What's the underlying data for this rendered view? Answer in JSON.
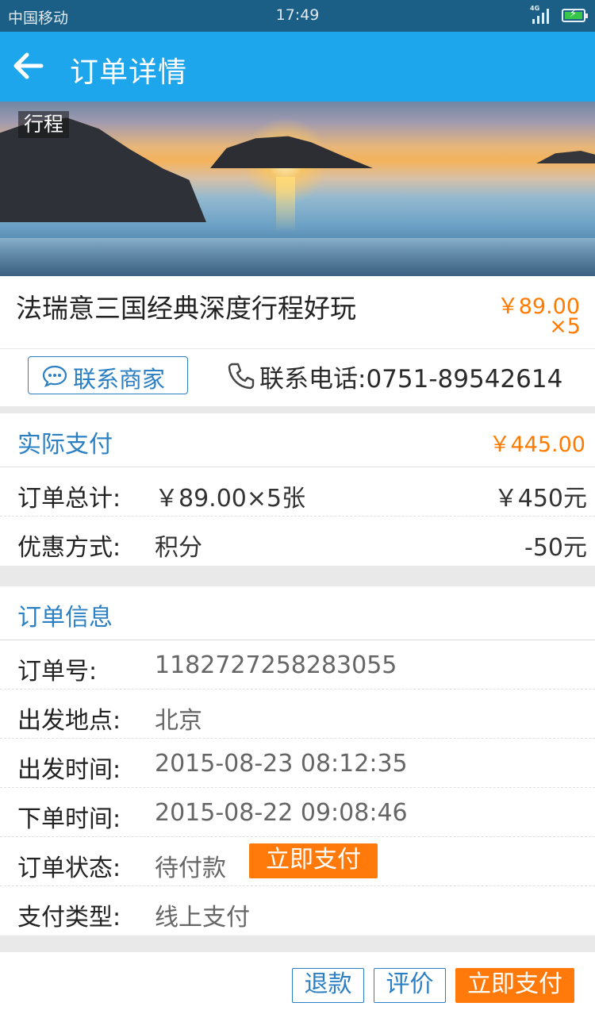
{
  "status_bar": {
    "carrier": "中国移动",
    "time": "17:49",
    "network": "4G"
  },
  "header": {
    "title": "订单详情"
  },
  "hero": {
    "tag": "行程"
  },
  "product": {
    "name": "法瑞意三国经典深度行程好玩",
    "unit_price": "￥89.00",
    "quantity": "×5"
  },
  "contact": {
    "merchant_button": "联系商家",
    "phone_text": "联系电话:0751-89542614"
  },
  "payment": {
    "title": "实际支付",
    "amount": "￥445.00",
    "rows": [
      {
        "key": "订单总计:",
        "value": "￥89.00×5张",
        "right": "￥450元"
      },
      {
        "key": "优惠方式:",
        "value": "积分",
        "right": "-50元"
      }
    ]
  },
  "order_info": {
    "title": "订单信息",
    "rows": [
      {
        "key": "订单号:",
        "value": "1182727258283055"
      },
      {
        "key": "出发地点:",
        "value": "北京"
      },
      {
        "key": "出发时间:",
        "value": "2015-08-23 08:12:35"
      },
      {
        "key": "下单时间:",
        "value": "2015-08-22 09:08:46"
      },
      {
        "key": "订单状态:",
        "value": "待付款",
        "action": "立即支付"
      },
      {
        "key": "支付类型:",
        "value": "线上支付"
      }
    ]
  },
  "actions": {
    "refund": "退款",
    "review": "评价",
    "pay_now": "立即支付"
  },
  "colors": {
    "status_bar": "#1c5f86",
    "header": "#1da6ec",
    "accent_orange": "#ff7a0a",
    "link_blue": "#2b80c4"
  }
}
